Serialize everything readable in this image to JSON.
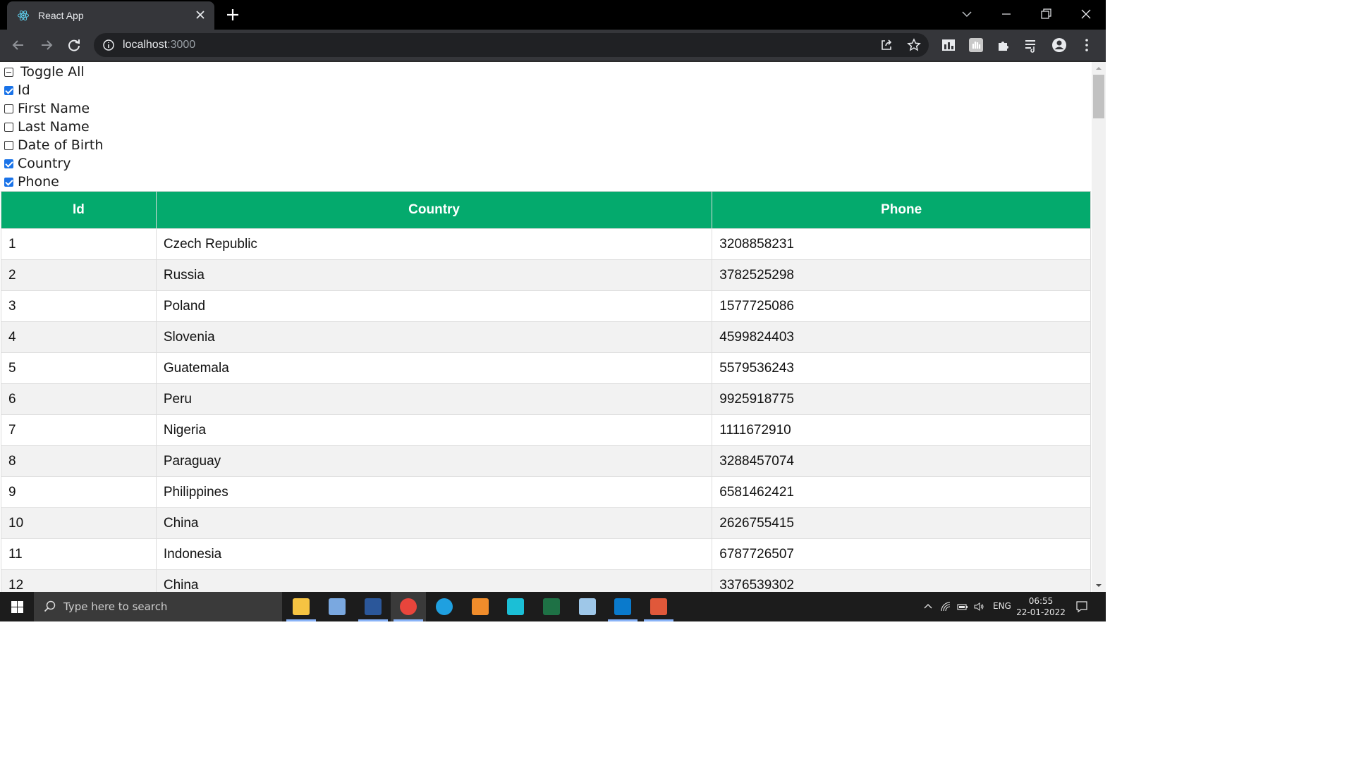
{
  "browser": {
    "tab_title": "React App",
    "url_host": "localhost",
    "url_port": ":3000"
  },
  "toggles": [
    {
      "label": "Toggle All",
      "state": "indeterminate"
    },
    {
      "label": "Id",
      "state": "checked"
    },
    {
      "label": "First Name",
      "state": "unchecked"
    },
    {
      "label": "Last Name",
      "state": "unchecked"
    },
    {
      "label": "Date of Birth",
      "state": "unchecked"
    },
    {
      "label": "Country",
      "state": "checked"
    },
    {
      "label": "Phone",
      "state": "checked"
    }
  ],
  "table": {
    "header_color": "#04aa6d",
    "columns": [
      "Id",
      "Country",
      "Phone"
    ],
    "rows": [
      [
        "1",
        "Czech Republic",
        "3208858231"
      ],
      [
        "2",
        "Russia",
        "3782525298"
      ],
      [
        "3",
        "Poland",
        "1577725086"
      ],
      [
        "4",
        "Slovenia",
        "4599824403"
      ],
      [
        "5",
        "Guatemala",
        "5579536243"
      ],
      [
        "6",
        "Peru",
        "9925918775"
      ],
      [
        "7",
        "Nigeria",
        "1111672910"
      ],
      [
        "8",
        "Paraguay",
        "3288457074"
      ],
      [
        "9",
        "Philippines",
        "6581462421"
      ],
      [
        "10",
        "China",
        "2626755415"
      ],
      [
        "11",
        "Indonesia",
        "6787726507"
      ],
      [
        "12",
        "China",
        "3376539302"
      ]
    ]
  },
  "taskbar": {
    "search_placeholder": "Type here to search",
    "apps": [
      {
        "name": "file-explorer",
        "color": "#f5c342",
        "running": true,
        "active": false
      },
      {
        "name": "paint",
        "color": "#7aa8e0",
        "running": false,
        "active": false
      },
      {
        "name": "word",
        "color": "#2b579a",
        "running": true,
        "active": false
      },
      {
        "name": "chrome",
        "color": "#e8453c",
        "running": true,
        "active": true
      },
      {
        "name": "edge",
        "color": "#1fa0e0",
        "running": false,
        "active": false
      },
      {
        "name": "sublime",
        "color": "#f08c2b",
        "running": false,
        "active": false
      },
      {
        "name": "touch-app",
        "color": "#1bbfd6",
        "running": false,
        "active": false
      },
      {
        "name": "excel",
        "color": "#1e7145",
        "running": false,
        "active": false
      },
      {
        "name": "notepad",
        "color": "#9ec7e8",
        "running": false,
        "active": false
      },
      {
        "name": "vscode",
        "color": "#0a7acc",
        "running": true,
        "active": false
      },
      {
        "name": "git",
        "color": "#e0583a",
        "running": true,
        "active": false
      }
    ],
    "language": "ENG",
    "time": "06:55",
    "date": "22-01-2022"
  }
}
